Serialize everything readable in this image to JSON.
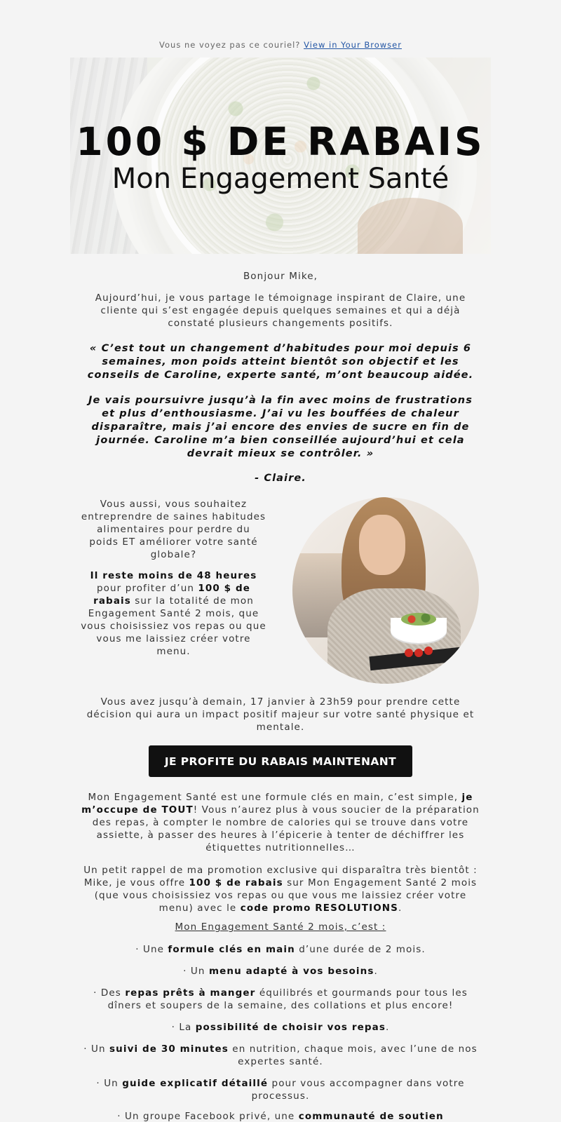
{
  "preheader": {
    "text": "Vous ne voyez pas ce couriel?",
    "link": "View in Your Browser"
  },
  "hero": {
    "title": "100 $ DE RABAIS",
    "subtitle": "Mon Engagement Santé"
  },
  "greeting": "Bonjour Mike,",
  "intro": "Aujourd’hui, je vous partage le témoignage inspirant de Claire, une cliente qui s’est engagée depuis quelques semaines et qui a déjà constaté plusieurs changements positifs.",
  "quote": {
    "p1": "« C’est tout un changement d’habitudes pour moi depuis 6 semaines, mon poids atteint bientôt son objectif et les conseils de Caroline, experte santé, m’ont beaucoup aidée.",
    "p2": "Je vais poursuivre jusqu’à la fin avec moins de frustrations et plus d’enthousiasme. J’ai vu les bouffées de chaleur disparaître, mais j’ai encore des envies de sucre en fin de journée. Caroline m’a bien conseillée aujourd’hui et cela devrait mieux se contrôler. »",
    "signature": "- Claire."
  },
  "column": {
    "p1": "Vous aussi, vous souhaitez entreprendre de saines habitudes alimentaires pour perdre du poids ET améliorer votre santé globale?",
    "p2_bold1": "Il reste moins de 48 heures",
    "p2_text1": " pour profiter d’un ",
    "p2_bold2": "100 $ de rabais",
    "p2_text2": " sur la totalité de mon Engagement Santé 2 mois, que vous choisissiez vos repas ou que vous me laissiez créer votre menu."
  },
  "deadline": "Vous avez jusqu’à demain, 17 janvier à 23h59 pour prendre cette décision qui aura un impact positif majeur sur votre santé physique et mentale.",
  "cta": "JE PROFITE DU RABAIS MAINTENANT",
  "formula": {
    "t1": "Mon Engagement Santé est une formule clés en main, c’est simple, ",
    "b1": "je m’occupe de TOUT",
    "t2": "! Vous n’aurez plus à vous soucier de la préparation des repas, à compter le nombre de calories qui se trouve dans votre assiette, à passer des heures à l’épicerie à tenter de déchiffrer les étiquettes nutritionnelles…"
  },
  "promo": {
    "t1": "Un petit rappel de ma promotion exclusive qui disparaîtra très bientôt : Mike, je vous offre ",
    "b1": "100 $ de rabais",
    "t2": " sur Mon Engagement Santé 2 mois (que vous choisissiez vos repas ou que vous me laissiez créer votre menu) avec le ",
    "b2": "code promo RESOLUTIONS",
    "t3": "."
  },
  "list_title": "Mon Engagement Santé 2 mois, c’est :",
  "bullets": [
    {
      "pre": "· Une ",
      "bold": "formule clés en main",
      "post": " d’une durée de 2 mois."
    },
    {
      "pre": "· Un ",
      "bold": "menu adapté à vos besoins",
      "post": "."
    },
    {
      "pre": "· Des ",
      "bold": "repas prêts à manger",
      "post": " équilibrés et gourmands pour tous les dîners et soupers de la semaine, des collations et plus encore!"
    },
    {
      "pre": "· La ",
      "bold": "possibilité de choisir vos repas",
      "post": "."
    },
    {
      "pre": "· Un ",
      "bold": "suivi de 30 minutes",
      "post": " en nutrition, chaque mois, avec l’une de nos expertes santé."
    },
    {
      "pre": "· Un ",
      "bold": "guide explicatif détaillé",
      "post": " pour vous accompagner dans votre processus."
    },
    {
      "pre": "· Un groupe Facebook privé, une ",
      "bold": "communauté de soutien",
      "post": ""
    }
  ]
}
